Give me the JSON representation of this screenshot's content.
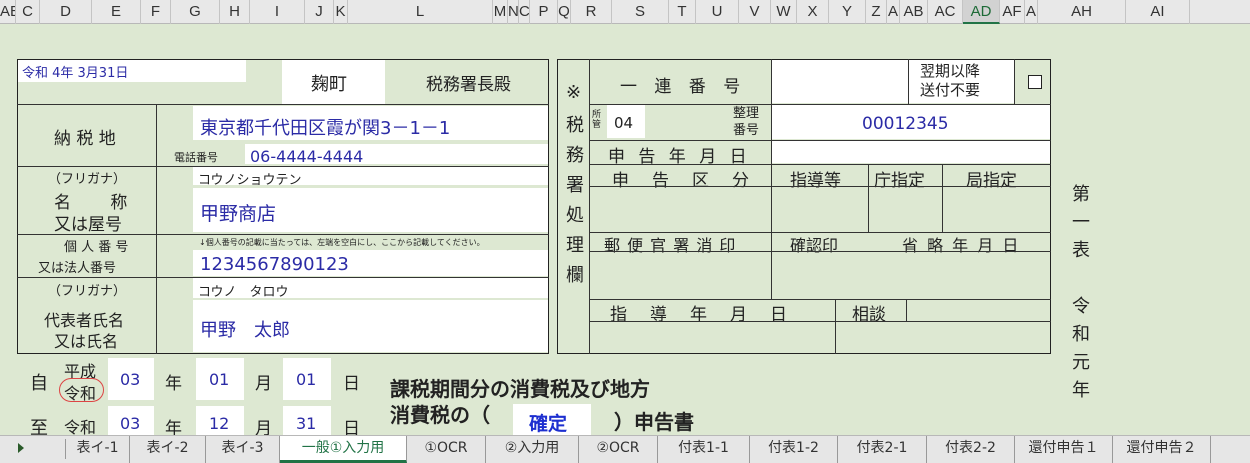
{
  "columns": [
    {
      "label": "AE",
      "w": 16
    },
    {
      "label": "C",
      "w": 24
    },
    {
      "label": "D",
      "w": 52
    },
    {
      "label": "E",
      "w": 49
    },
    {
      "label": "F",
      "w": 30
    },
    {
      "label": "G",
      "w": 49
    },
    {
      "label": "H",
      "w": 30
    },
    {
      "label": "I",
      "w": 55
    },
    {
      "label": "J",
      "w": 29
    },
    {
      "label": "K",
      "w": 14
    },
    {
      "label": "L",
      "w": 145
    },
    {
      "label": "M",
      "w": 15
    },
    {
      "label": "N",
      "w": 11
    },
    {
      "label": "C",
      "w": 11
    },
    {
      "label": "P",
      "w": 28
    },
    {
      "label": "Q",
      "w": 13
    },
    {
      "label": "R",
      "w": 41
    },
    {
      "label": "S",
      "w": 57
    },
    {
      "label": "T",
      "w": 27
    },
    {
      "label": "U",
      "w": 43
    },
    {
      "label": "V",
      "w": 32
    },
    {
      "label": "W",
      "w": 26
    },
    {
      "label": "X",
      "w": 32
    },
    {
      "label": "Y",
      "w": 37
    },
    {
      "label": "Z",
      "w": 21
    },
    {
      "label": "A",
      "w": 13
    },
    {
      "label": "AB",
      "w": 28
    },
    {
      "label": "AC",
      "w": 35
    },
    {
      "label": "AD",
      "w": 37
    },
    {
      "label": "AF",
      "w": 25
    },
    {
      "label": "A",
      "w": 13
    },
    {
      "label": "AH",
      "w": 88
    },
    {
      "label": "AI",
      "w": 64
    }
  ],
  "active_column": "AD",
  "form": {
    "date": "令和 4年 3月31日",
    "office": "麹町",
    "office_suffix": "税務署長殿",
    "address_label": "納 税 地",
    "address": "東京都千代田区霞が関3－1－1",
    "phone_label": "電話番号",
    "phone": "06-4444-4444",
    "furigana_label": "（フリガナ）",
    "name_kana": "コウノショウテン",
    "name_label_1": "名　　 称",
    "name_label_2": "又は屋号",
    "name": "甲野商店",
    "mynumber_label_1": "個 人 番 号",
    "mynumber_label_2": "又は法人番号",
    "mynumber_note": "↓個人番号の記載に当たっては、左端を空白にし、ここから記載してください。",
    "mynumber": "1234567890123",
    "rep_furigana_label": "（フリガナ）",
    "rep_kana": "コウノ　タロウ",
    "rep_label_1": "代表者氏名",
    "rep_label_2": "又は氏名",
    "rep_name": "甲野　太郎"
  },
  "office_panel": {
    "vertical_label": "※税務署処理欄",
    "serial_label": "一 連 番 号",
    "next_period": "翌期以降\n送付不要",
    "shokan_label": "所管",
    "shokan_value": "04",
    "seiri_label": "整理\n番号",
    "seiri_value": "00012345",
    "shinkoku_date": "申 告 年 月 日",
    "shinkoku_kubun": "申　告　区　分",
    "shido": "指導等",
    "chou": "庁指定",
    "kyoku": "局指定",
    "tsushin": "郵 便 官 署 消 印",
    "kakunin": "確認印",
    "shoryaku": "省 略 年 月 日",
    "shido_date": "指　導　年　月　日",
    "soudan": "相談"
  },
  "side_text": "第一表　令和元年",
  "period": {
    "from_label": "自",
    "to_label": "至",
    "era_heisei": "平成",
    "era_reiwa": "令和",
    "from_year": "03",
    "from_month": "01",
    "from_day": "01",
    "to_year": "03",
    "to_month": "12",
    "to_day": "31",
    "year_unit": "年",
    "month_unit": "月",
    "day_unit": "日"
  },
  "title": {
    "line1": "課税期間分の消費税及び地方",
    "line2": "消費税の（",
    "kind": "確定",
    "line2_end": "）申告書"
  },
  "tabs": [
    {
      "label": "表イ-1",
      "w": 64
    },
    {
      "label": "表イ-2",
      "w": 76
    },
    {
      "label": "表イ-3",
      "w": 74
    },
    {
      "label": "一般①入力用",
      "w": 127
    },
    {
      "label": "①OCR",
      "w": 79
    },
    {
      "label": "②入力用",
      "w": 93
    },
    {
      "label": "②OCR",
      "w": 79
    },
    {
      "label": "付表1-1",
      "w": 92
    },
    {
      "label": "付表1-2",
      "w": 88
    },
    {
      "label": "付表2-1",
      "w": 89
    },
    {
      "label": "付表2-2",
      "w": 88
    },
    {
      "label": "還付申告１",
      "w": 98
    },
    {
      "label": "還付申告２",
      "w": 98
    }
  ],
  "active_tab": "一般①入力用"
}
